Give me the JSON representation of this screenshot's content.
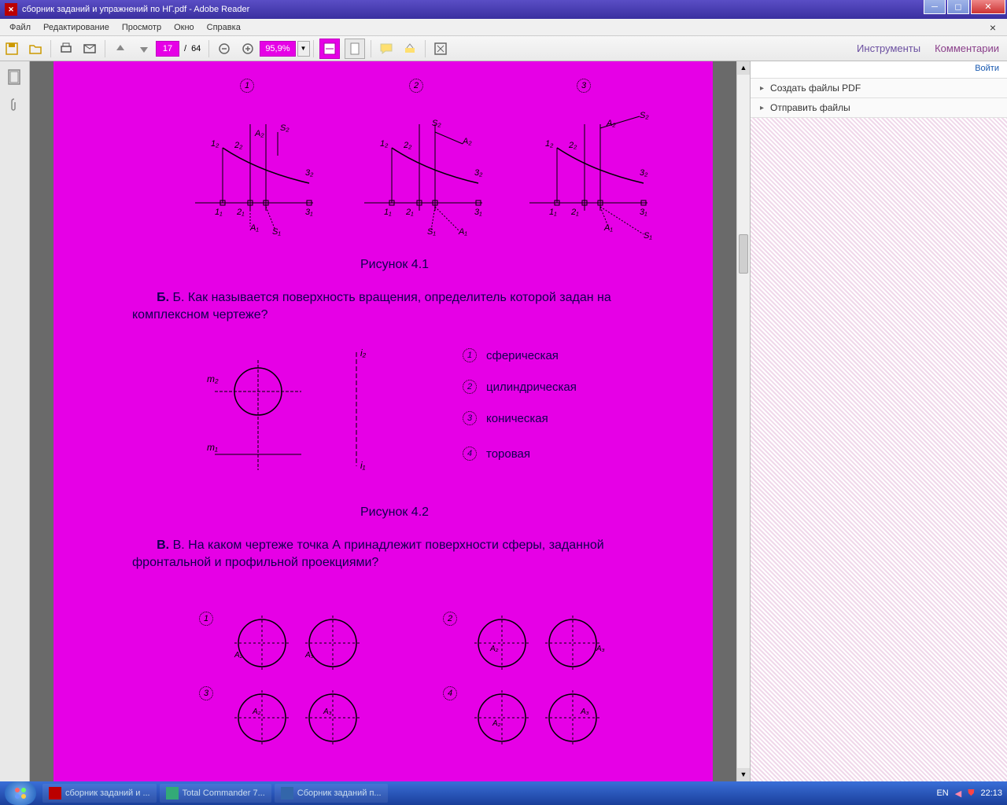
{
  "title": "сборник заданий и упражнений по НГ.pdf - Adobe Reader",
  "menu": {
    "file": "Файл",
    "edit": "Редактирование",
    "view": "Просмотр",
    "window": "Окно",
    "help": "Справка"
  },
  "toolbar": {
    "page_current": "17",
    "page_sep": "/",
    "page_total": "64",
    "zoom": "95,9%",
    "tools": "Инструменты",
    "comments": "Комментарии"
  },
  "right_panel": {
    "login": "Войти",
    "create_pdf": "Создать файлы PDF",
    "send_files": "Отправить файлы"
  },
  "taskbar": {
    "app1": "сборник заданий и ...",
    "app2": "Total Commander 7...",
    "app3": "Сборник заданий п...",
    "lang": "EN",
    "time": "22:13"
  },
  "doc": {
    "num1": "1",
    "num2": "2",
    "num3": "3",
    "num4": "4",
    "fig41": "Рисунок 4.1",
    "textB": "Б. Как называется поверхность вращения, определитель которой задан на комплексном чертеже?",
    "opt1": "сферическая",
    "opt2": "цилиндрическая",
    "opt3": "коническая",
    "opt4": "торовая",
    "fig42": "Рисунок 4.2",
    "textV": "В. На каком чертеже точка А принадлежит поверхности сферы, заданной фронтальной и профильной проекциями?",
    "labels": {
      "A1": "A₁",
      "A2": "A₂",
      "S1": "S₁",
      "S2": "S₂",
      "I1": "1₁",
      "I2": "1₂",
      "II1": "2₁",
      "II2": "2₂",
      "III1": "3₁",
      "III2": "3₂",
      "m1": "m₁",
      "m2": "m₂",
      "i1": "i₁",
      "i2": "i₂",
      "A3": "A₃"
    }
  }
}
